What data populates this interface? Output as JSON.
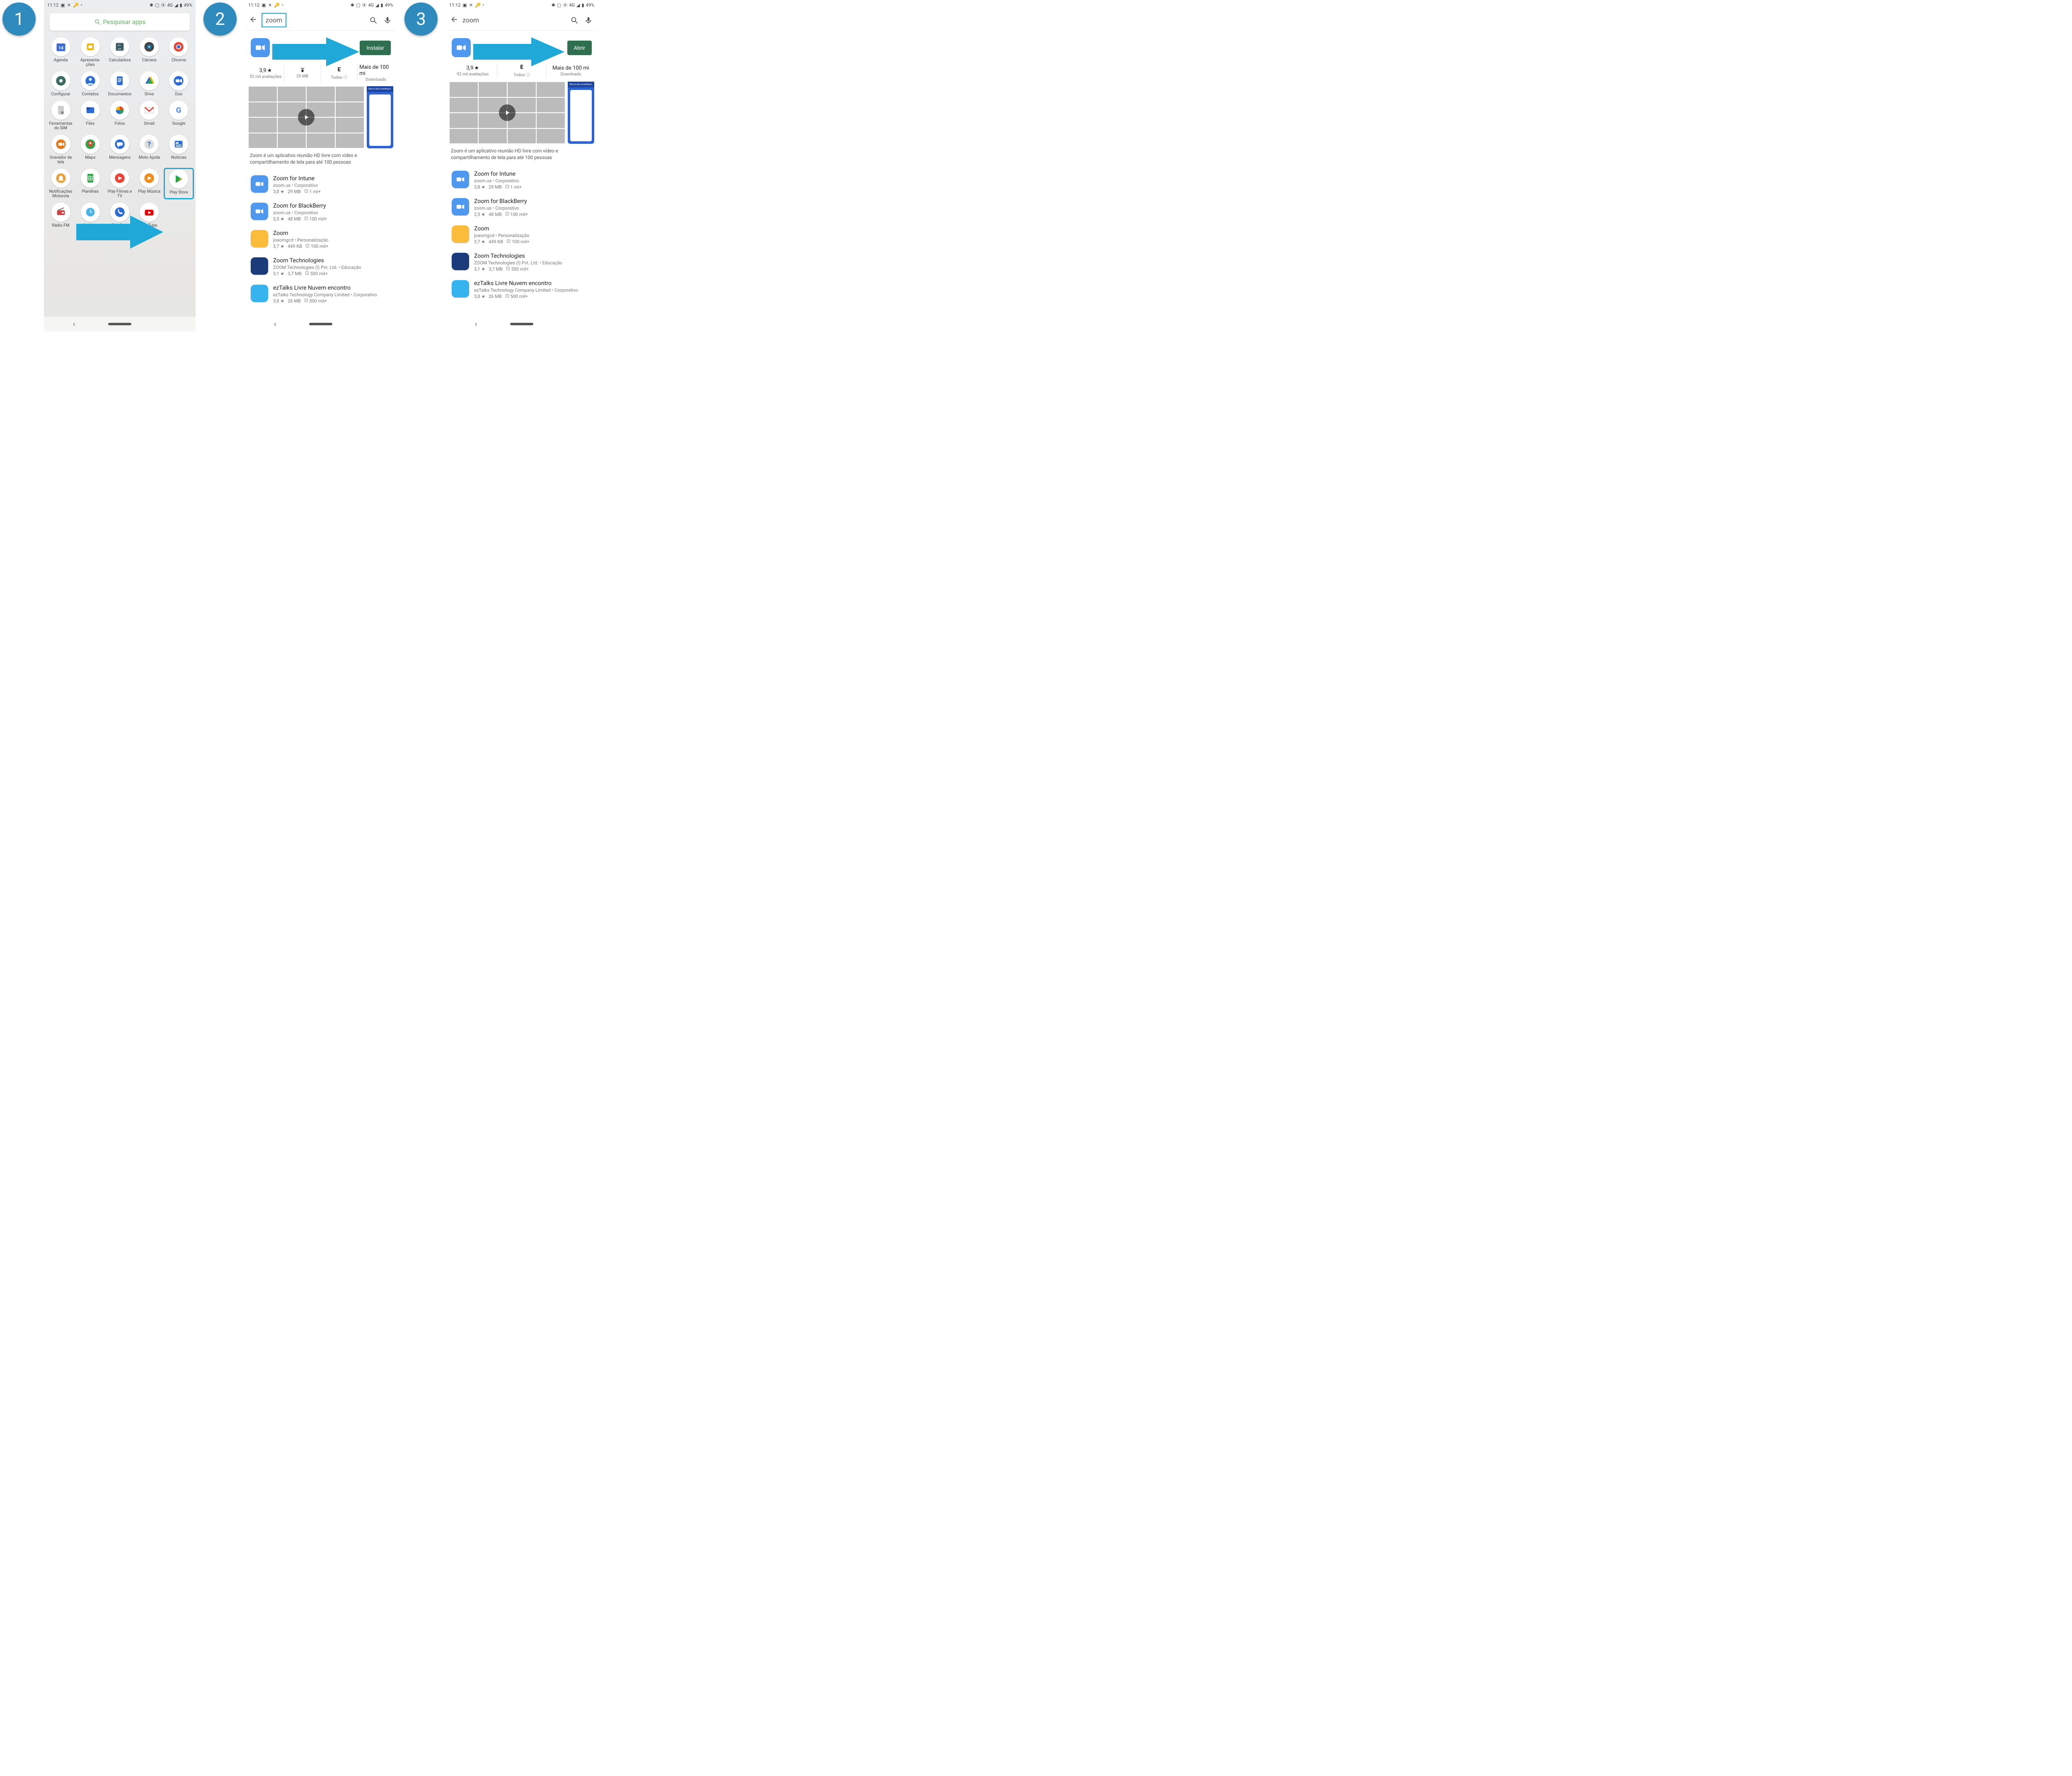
{
  "status": {
    "time": "11:12",
    "battery": "49%",
    "net": "4G"
  },
  "drawer": {
    "search_placeholder": "Pesquisar apps",
    "apps": [
      {
        "label": "Agenda",
        "icon": "calendar",
        "glyph": "14"
      },
      {
        "label": "Apresenta-\nções",
        "icon": "slides"
      },
      {
        "label": "Calculadora",
        "icon": "calc"
      },
      {
        "label": "Câmera",
        "icon": "camera"
      },
      {
        "label": "Chrome",
        "icon": "chrome"
      },
      {
        "label": "Configurar",
        "icon": "gear"
      },
      {
        "label": "Contatos",
        "icon": "contact"
      },
      {
        "label": "Documentos",
        "icon": "docs"
      },
      {
        "label": "Drive",
        "icon": "drive"
      },
      {
        "label": "Duo",
        "icon": "duo"
      },
      {
        "label": "Ferramentas do SIM",
        "icon": "sim"
      },
      {
        "label": "Files",
        "icon": "files"
      },
      {
        "label": "Fotos",
        "icon": "photos"
      },
      {
        "label": "Gmail",
        "icon": "gmail"
      },
      {
        "label": "Google",
        "icon": "google"
      },
      {
        "label": "Gravador de tela",
        "icon": "record"
      },
      {
        "label": "Maps",
        "icon": "maps"
      },
      {
        "label": "Mensagens",
        "icon": "messages"
      },
      {
        "label": "Moto Ajuda",
        "icon": "help"
      },
      {
        "label": "Notícias",
        "icon": "news"
      },
      {
        "label": "Notificações Motorola",
        "icon": "notif"
      },
      {
        "label": "Planilhas",
        "icon": "sheets"
      },
      {
        "label": "Play Filmes e TV",
        "icon": "playmovies"
      },
      {
        "label": "Play Música",
        "icon": "playmusic"
      },
      {
        "label": "Play Store",
        "icon": "playstore",
        "highlight": true
      },
      {
        "label": "Rádio FM",
        "icon": "radio"
      },
      {
        "label": "Relógio",
        "icon": "clock"
      },
      {
        "label": "Telefone",
        "icon": "phone"
      },
      {
        "label": "YouTube",
        "icon": "youtube"
      }
    ]
  },
  "store": {
    "query": "zoom",
    "install_label": "Instalar",
    "open_label": "Abrir",
    "rating": "3,9",
    "rating_count": "92 mil avaliações",
    "size": "29 MB",
    "pegi": "E",
    "pegi_label": "Todos",
    "downloads_top": "Mais de 100 mi",
    "downloads_bot": "Downloads",
    "gallery_banner": "Start or join a meeting in",
    "description": "Zoom é um aplicativo reunião HD livre com vídeo e compartilhamento de tela para até 100 pessoas",
    "list": [
      {
        "title": "Zoom for Intune",
        "pub": "zoom.us",
        "cat": "Corporativo",
        "rating": "3,8",
        "size": "29 MB",
        "dl": "1 mi+",
        "icon": "zoom"
      },
      {
        "title": "Zoom for BlackBerry",
        "pub": "zoom.us",
        "cat": "Corporativo",
        "rating": "3,5",
        "size": "48 MB",
        "dl": "100 mil+",
        "icon": "zoom"
      },
      {
        "title": "Zoom",
        "pub": "joaomgcd",
        "cat": "Personalização",
        "rating": "3,7",
        "size": "449 KB",
        "dl": "100 mil+",
        "icon": "alt1"
      },
      {
        "title": "Zoom Technologies",
        "pub": "ZOOM Technologies (I) Pvt. Ltd.",
        "cat": "Educação",
        "rating": "3,1",
        "size": "3,7 MB",
        "dl": "500 mil+",
        "icon": "alt2"
      },
      {
        "title": "ezTalks Livre Nuvem encontro",
        "pub": "ezTalks Technology Company Limited",
        "cat": "Corporativo",
        "rating": "3,8",
        "size": "26 MB",
        "dl": "500 mil+",
        "icon": "alt3"
      }
    ]
  },
  "steps": {
    "s1": "1",
    "s2": "2",
    "s3": "3"
  }
}
